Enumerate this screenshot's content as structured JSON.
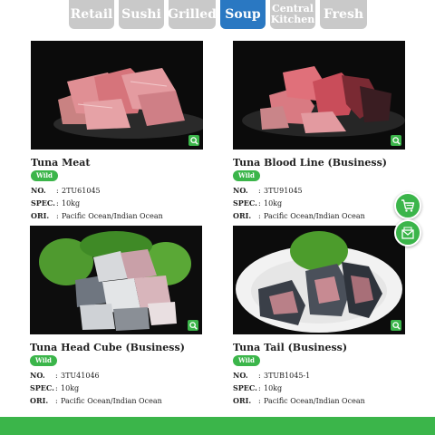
{
  "tabs": [
    {
      "label": "Retail",
      "active": false
    },
    {
      "label": "Sushi",
      "active": false
    },
    {
      "label": "Grilled",
      "active": false
    },
    {
      "label": "Soup",
      "active": true
    },
    {
      "label": "Central Kitchen",
      "line1": "Central",
      "line2": "Kitchen",
      "active": false
    },
    {
      "label": "Fresh",
      "active": false
    }
  ],
  "products": [
    {
      "name": "Tuna Meat",
      "badge": "Wild",
      "no_label": "NO.",
      "no": "2TU61045",
      "spec_label": "SPEC.",
      "spec": "10kg",
      "ori_label": "ORI.",
      "ori": "Pacific Ocean/Indian Ocean"
    },
    {
      "name": "Tuna Blood Line (Business)",
      "badge": "Wild",
      "no_label": "NO.",
      "no": "3TU91045",
      "spec_label": "SPEC.",
      "spec": "10kg",
      "ori_label": "ORI.",
      "ori": "Pacific Ocean/Indian Ocean"
    },
    {
      "name": "Tuna Head Cube (Business)",
      "badge": "Wild",
      "no_label": "NO.",
      "no": "3TU41046",
      "spec_label": "SPEC.",
      "spec": "10kg",
      "ori_label": "ORI.",
      "ori": "Pacific Ocean/Indian Ocean"
    },
    {
      "name": "Tuna Tail (Business)",
      "badge": "Wild",
      "no_label": "NO.",
      "no": "3TUB1045-1",
      "spec_label": "SPEC.",
      "spec": "10kg",
      "ori_label": "ORI.",
      "ori": "Pacific Ocean/Indian Ocean"
    }
  ],
  "colors": {
    "accent_green": "#3bb54a",
    "active_tab": "#2a78c2",
    "inactive_tab": "#c9c9c9"
  },
  "icons": {
    "zoom": "zoom-in-icon",
    "cart": "shopping-cart-icon",
    "mail": "mail-icon"
  }
}
